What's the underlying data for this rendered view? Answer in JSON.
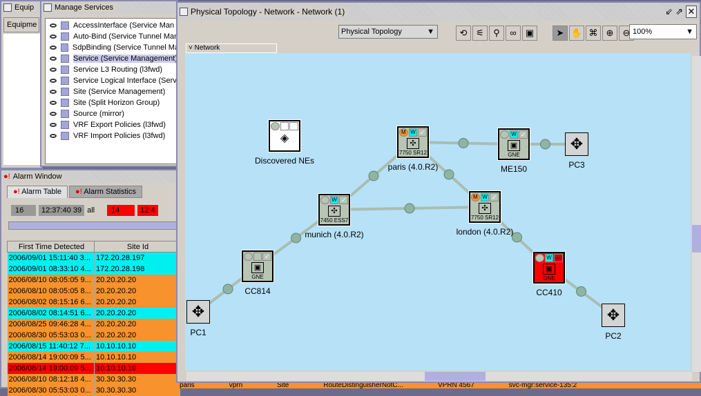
{
  "equipment": {
    "title": "Equip",
    "tab": "Equipme"
  },
  "manage_services": {
    "title": "Manage Services",
    "items": [
      "AccessInterface (Service Man",
      "Auto-Bind (Service Tunnel Man",
      "SdpBinding (Service Tunnel Ma",
      "Service (Service Management)",
      "Service L3 Routing (l3fwd)",
      "Service Logical Interface (Serv",
      "Site (Service Management)",
      "Site (Split Horizon Group)",
      "Source (mirror)",
      "VRF Export Policies (l3fwd)",
      "VRF Import Policies (l3fwd)"
    ],
    "selected_index": 3
  },
  "alarm_window": {
    "title": "Alarm Window",
    "tabs": [
      "Alarm Table",
      "Alarm Statistics"
    ],
    "summary": {
      "count1": "16",
      "time1": "12:37:40 39",
      "filter1": "all",
      "count2": "14",
      "time2": "12:4"
    },
    "columns": [
      "First Time Detected",
      "Site Id"
    ],
    "rows": [
      {
        "time": "2006/09/01 15:11:40 3...",
        "site": "172.20.28.197",
        "color": "cyan"
      },
      {
        "time": "2006/09/01 08:33:10 4...",
        "site": "172.20.28.198",
        "color": "cyan"
      },
      {
        "time": "2006/08/10 08:05:05 9...",
        "site": "20.20.20.20",
        "color": "orange"
      },
      {
        "time": "2006/08/10 08:05:05 8...",
        "site": "20.20.20.20",
        "color": "orange"
      },
      {
        "time": "2006/08/02 08:15:16 6...",
        "site": "20.20.20.20",
        "color": "orange"
      },
      {
        "time": "2006/08/02 08:14:51 6...",
        "site": "20.20.20.20",
        "color": "cyan"
      },
      {
        "time": "2006/08/25 09:46:28 4...",
        "site": "20.20.20.20",
        "color": "orange"
      },
      {
        "time": "2006/08/30 05:53:03 0...",
        "site": "20.20.20.20",
        "color": "orange"
      },
      {
        "time": "2006/08/15 11:40:12 7...",
        "site": "10.10.10.10",
        "color": "cyan"
      },
      {
        "time": "2006/08/14 19:00:09 5...",
        "site": "10.10.10.10",
        "color": "orange"
      },
      {
        "time": "2006/08/14 19:00:09 5...",
        "site": "10.10.10.10",
        "color": "red"
      },
      {
        "time": "2006/08/10 08:12:18 4...",
        "site": "30.30.30.30",
        "color": "orange"
      },
      {
        "time": "2006/08/30 05:53:03 0...",
        "site": "30.30.30.30",
        "color": "orange"
      }
    ]
  },
  "topology": {
    "title": "Physical Topology - Network - Network (1)",
    "view_select": "Physical Topology",
    "zoom": "100%",
    "breadcrumb": "Network",
    "toolbar_icons": [
      "refresh-icon",
      "filter-icon",
      "find-binoculars-icon",
      "link-icon",
      "window-icon",
      "select-arrow-icon",
      "pan-hand-icon",
      "layout-icon",
      "zoom-in-icon",
      "zoom-out-icon"
    ],
    "nodes": [
      {
        "id": "discovered",
        "label": "Discovered NEs",
        "type": "group"
      },
      {
        "id": "paris",
        "label": "paris (4.0.R2)",
        "model": "7750 SR12",
        "alarm": "major"
      },
      {
        "id": "me150",
        "label": "ME150",
        "model": "GNE"
      },
      {
        "id": "pc3",
        "label": "PC3",
        "type": "pc"
      },
      {
        "id": "munich",
        "label": "munich (4.0.R2)",
        "model": "7450 ESS7"
      },
      {
        "id": "london",
        "label": "london (4.0.R2)",
        "model": "7750 SR12",
        "alarm": "major"
      },
      {
        "id": "cc814",
        "label": "CC814",
        "model": "GNE"
      },
      {
        "id": "cc410",
        "label": "CC410",
        "model": "GNE",
        "alarm": "critical"
      },
      {
        "id": "pc1",
        "label": "PC1",
        "type": "pc"
      },
      {
        "id": "pc2",
        "label": "PC2",
        "type": "pc"
      }
    ],
    "links": [
      [
        "paris",
        "me150"
      ],
      [
        "me150",
        "pc3"
      ],
      [
        "paris",
        "munich"
      ],
      [
        "paris",
        "london"
      ],
      [
        "munich",
        "london"
      ],
      [
        "munich",
        "cc814"
      ],
      [
        "cc814",
        "pc1"
      ],
      [
        "london",
        "cc410"
      ],
      [
        "cc410",
        "pc2"
      ]
    ]
  },
  "bottom_row": [
    "paris",
    "vprn",
    "Site",
    "RouteDistinguisherNotC...",
    "VPRN 4567",
    "svc-mgr:service-135:2"
  ],
  "colors": {
    "canvas": "#b7e1f7",
    "node": "#b8c4b4",
    "critical": "#ff0000",
    "major": "#f7922d",
    "cyan": "#00f0f0"
  }
}
